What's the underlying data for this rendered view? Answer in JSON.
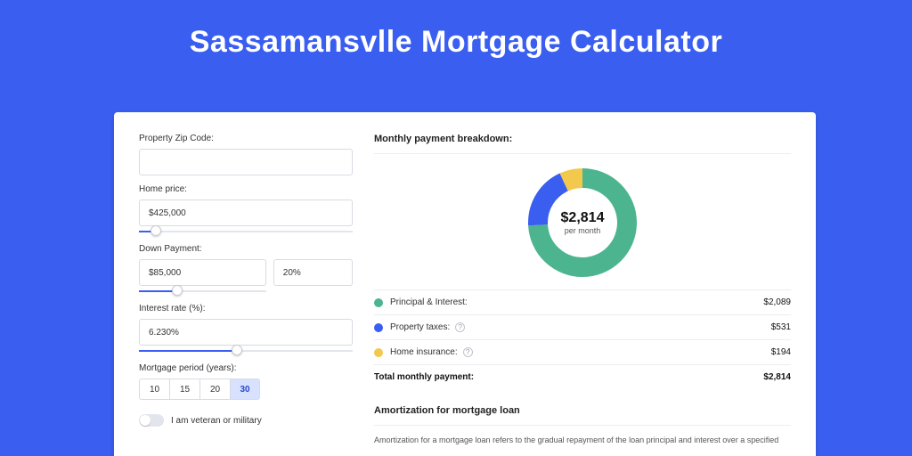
{
  "page": {
    "title": "Sassamansvlle Mortgage Calculator"
  },
  "form": {
    "zip_label": "Property Zip Code:",
    "zip_value": "",
    "home_price_label": "Home price:",
    "home_price_value": "$425,000",
    "home_price_slider_pct": 8,
    "down_label": "Down Payment:",
    "down_value": "$85,000",
    "down_pct_value": "20%",
    "down_slider_pct": 30,
    "rate_label": "Interest rate (%):",
    "rate_value": "6.230%",
    "rate_slider_pct": 46,
    "period_label": "Mortgage period (years):",
    "period_options": [
      "10",
      "15",
      "20",
      "30"
    ],
    "period_active": "30",
    "veteran_label": "I am veteran or military"
  },
  "breakdown": {
    "title": "Monthly payment breakdown:",
    "center_amount": "$2,814",
    "center_sub": "per month",
    "items": [
      {
        "label": "Principal & Interest:",
        "value": "$2,089",
        "color": "#4cb58f",
        "pct": 74,
        "info": false
      },
      {
        "label": "Property taxes:",
        "value": "$531",
        "color": "#3a5ef0",
        "pct": 19,
        "info": true
      },
      {
        "label": "Home insurance:",
        "value": "$194",
        "color": "#f2c94c",
        "pct": 7,
        "info": true
      }
    ],
    "total_label": "Total monthly payment:",
    "total_value": "$2,814"
  },
  "amortization": {
    "title": "Amortization for mortgage loan",
    "text": "Amortization for a mortgage loan refers to the gradual repayment of the loan principal and interest over a specified"
  },
  "chart_data": {
    "type": "pie",
    "title": "Monthly payment breakdown",
    "series": [
      {
        "name": "Principal & Interest",
        "value": 2089,
        "color": "#4cb58f"
      },
      {
        "name": "Property taxes",
        "value": 531,
        "color": "#3a5ef0"
      },
      {
        "name": "Home insurance",
        "value": 194,
        "color": "#f2c94c"
      }
    ],
    "total": 2814,
    "center_label": "$2,814 per month"
  }
}
